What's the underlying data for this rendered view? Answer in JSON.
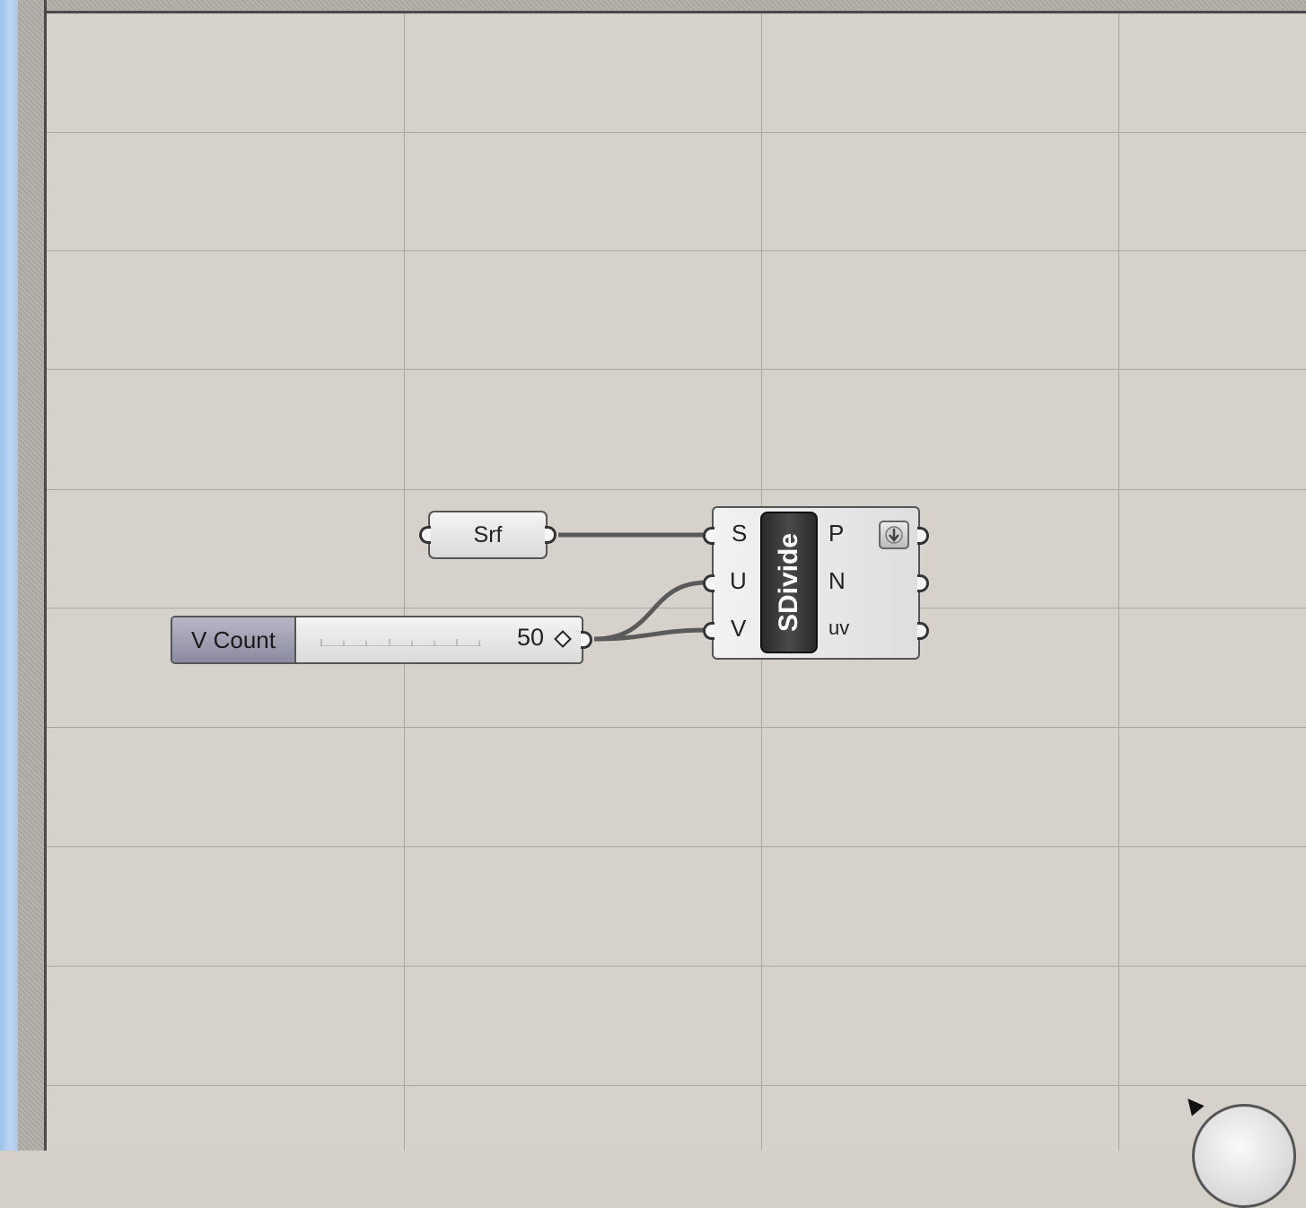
{
  "canvas": {
    "background": "#d6d2cb",
    "grid_color": "#aaa79f"
  },
  "srf_param": {
    "label": "Srf"
  },
  "vcount_slider": {
    "label": "V Count",
    "value": "50",
    "label_color": "#9a98ae"
  },
  "sdivide": {
    "title": "SDivide",
    "inputs": [
      "S",
      "U",
      "V"
    ],
    "outputs": [
      "P",
      "N",
      "uv"
    ]
  },
  "wire_color": "#5a5a5a"
}
